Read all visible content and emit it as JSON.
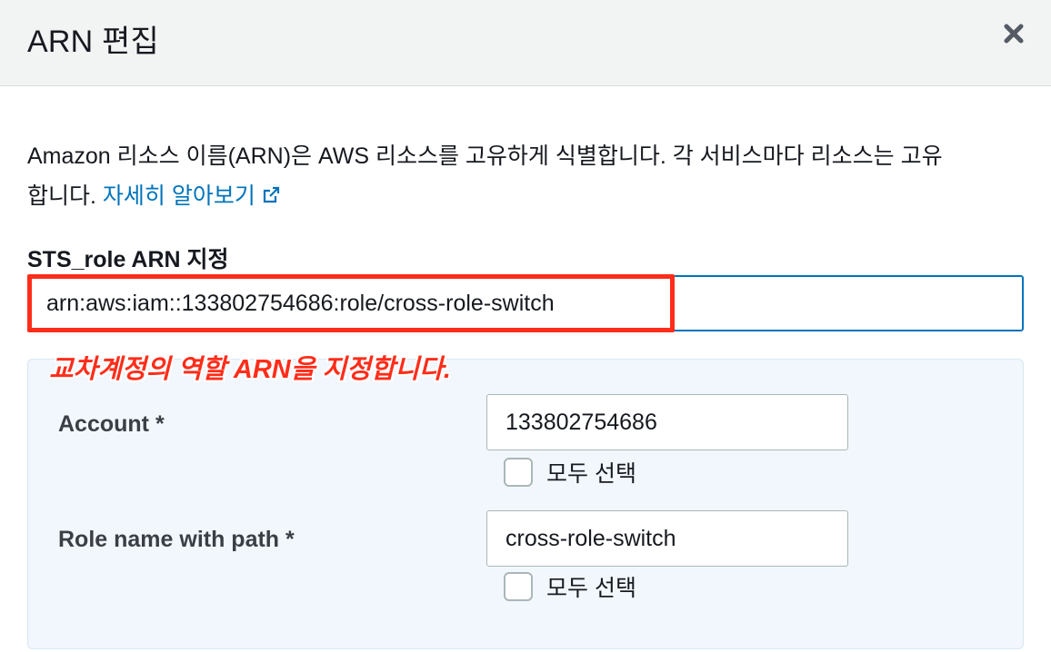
{
  "dialog": {
    "title": "ARN 편집",
    "close_icon": "close-icon"
  },
  "description": {
    "line1": "Amazon 리소스 이름(ARN)은 AWS 리소스를 고유하게 식별합니다. 각 서비스마다 리소스는 고유",
    "line2_prefix": "합니다. ",
    "learn_more": "자세히 알아보기",
    "external_icon": "external-link-icon"
  },
  "arn_field": {
    "label": "STS_role ARN 지정",
    "value": "arn:aws:iam::133802754686:role/cross-role-switch"
  },
  "annotation": {
    "text": "교차계정의 역할 ARN을 지정합니다.",
    "color": "#ff2d1a"
  },
  "fields": [
    {
      "label": "Account *",
      "value": "133802754686",
      "checkbox_label": "모두 선택",
      "checked": false
    },
    {
      "label": "Role name with path *",
      "value": "cross-role-switch",
      "checkbox_label": "모두 선택",
      "checked": false
    }
  ],
  "colors": {
    "link": "#0073bb",
    "header_bg": "#f2f3f3",
    "panel_bg": "#f1f7fc",
    "highlight": "#ff2d1a"
  }
}
